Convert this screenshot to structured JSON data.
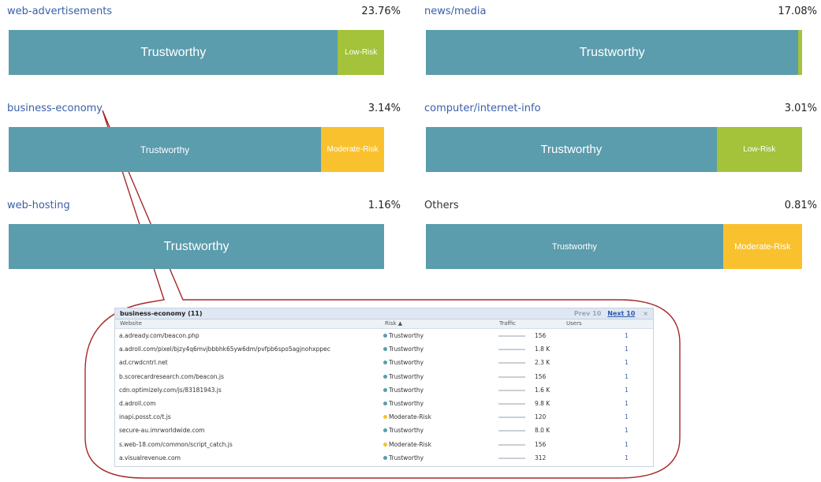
{
  "categories": [
    {
      "name": "web-advertisements",
      "percent": "23.76%",
      "link": true,
      "segments": [
        {
          "label": "Trustworthy",
          "kind": "trust",
          "share": 0.877
        },
        {
          "label": "Low-Risk",
          "kind": "low",
          "share": 0.123
        }
      ]
    },
    {
      "name": "news/media",
      "percent": "17.08%",
      "link": true,
      "segments": [
        {
          "label": "Trustworthy",
          "kind": "trust",
          "share": 0.99
        },
        {
          "label": "",
          "kind": "low",
          "share": 0.01
        }
      ]
    },
    {
      "name": "business-economy",
      "percent": "3.14%",
      "link": true,
      "segments": [
        {
          "label": "Trustworthy",
          "kind": "trust",
          "share": 0.832
        },
        {
          "label": "Moderate-Risk",
          "kind": "mod",
          "share": 0.168
        }
      ]
    },
    {
      "name": "computer/internet-info",
      "percent": "3.01%",
      "link": true,
      "segments": [
        {
          "label": "Trustworthy",
          "kind": "trust",
          "share": 0.773
        },
        {
          "label": "Low-Risk",
          "kind": "low",
          "share": 0.227
        }
      ]
    },
    {
      "name": "web-hosting",
      "percent": "1.16%",
      "link": true,
      "segments": [
        {
          "label": "Trustworthy",
          "kind": "trust",
          "share": 1.0
        }
      ]
    },
    {
      "name": "Others",
      "percent": "0.81%",
      "link": false,
      "segments": [
        {
          "label": "Trustworthy",
          "kind": "trust",
          "share": 0.79
        },
        {
          "label": "Moderate-Risk",
          "kind": "mod",
          "share": 0.21
        }
      ]
    }
  ],
  "popup": {
    "title": "business-economy (11)",
    "prev_label": "Prev 10",
    "next_label": "Next 10",
    "close_label": "×",
    "columns": {
      "website": "Website",
      "risk": "Risk ▲",
      "traffic": "Traffic",
      "users": "Users"
    },
    "rows": [
      {
        "site": "a.adready.com/beacon.php",
        "risk": "Trustworthy",
        "risk_kind": "trust",
        "traffic": "156",
        "users": "1"
      },
      {
        "site": "a.adroll.com/pixel/bjzy4q6mvjbbbhk65yw6dm/pvfpb6spo5agjnohxppec",
        "risk": "Trustworthy",
        "risk_kind": "trust",
        "traffic": "1.8 K",
        "users": "1"
      },
      {
        "site": "ad.crwdcntrl.net",
        "risk": "Trustworthy",
        "risk_kind": "trust",
        "traffic": "2.3 K",
        "users": "1"
      },
      {
        "site": "b.scorecardresearch.com/beacon.js",
        "risk": "Trustworthy",
        "risk_kind": "trust",
        "traffic": "156",
        "users": "1"
      },
      {
        "site": "cdn.optimizely.com/js/83181943.js",
        "risk": "Trustworthy",
        "risk_kind": "trust",
        "traffic": "1.6 K",
        "users": "1"
      },
      {
        "site": "d.adroll.com",
        "risk": "Trustworthy",
        "risk_kind": "trust",
        "traffic": "9.8 K",
        "users": "1"
      },
      {
        "site": "inapi.posst.co/t.js",
        "risk": "Moderate-Risk",
        "risk_kind": "mod",
        "traffic": "120",
        "users": "1"
      },
      {
        "site": "secure-au.imrworldwide.com",
        "risk": "Trustworthy",
        "risk_kind": "trust",
        "traffic": "8.0 K",
        "users": "1"
      },
      {
        "site": "s.web-18.com/common/script_catch.js",
        "risk": "Moderate-Risk",
        "risk_kind": "mod",
        "traffic": "156",
        "users": "1"
      },
      {
        "site": "a.visualrevenue.com",
        "risk": "Trustworthy",
        "risk_kind": "trust",
        "traffic": "312",
        "users": "1"
      }
    ]
  }
}
